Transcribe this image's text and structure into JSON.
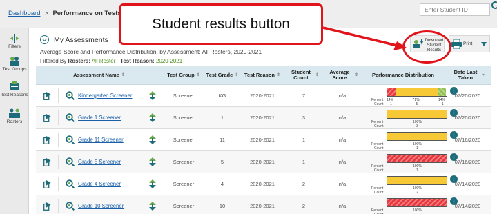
{
  "breadcrumb": {
    "root": "Dashboard",
    "separator": ">",
    "current": "Performance on Tests"
  },
  "search": {
    "placeholder": "Enter Student ID"
  },
  "callout": {
    "text": "Student results button"
  },
  "rail": [
    {
      "label": "Filters",
      "icon": "filters-icon"
    },
    {
      "label": "Test Groups",
      "icon": "test-groups-icon"
    },
    {
      "label": "Test Reasons",
      "icon": "test-reasons-icon"
    },
    {
      "label": "Rosters",
      "icon": "rosters-icon"
    }
  ],
  "page": {
    "title": "My Assessments",
    "subtitle": "Average Score and Performance Distribution, by Assessment: All Rosters, 2020-2021",
    "filtered_by": "Filtered By",
    "rosters_label": "Rosters:",
    "rosters_value": "All Roster",
    "reason_label": "Test Reason:",
    "reason_value": "2020-2021"
  },
  "toolbar": {
    "download_label": "Download Student Results",
    "print_label": "Print"
  },
  "colors": {
    "accent": "#1d6c7b",
    "link": "#1a5fa8",
    "callout": "#e0141a",
    "header_bg": "#d9e9ef"
  },
  "table": {
    "headers": {
      "name": "Assessment Name",
      "group": "Test Group",
      "grade": "Test Grade",
      "reason": "Test Reason",
      "count": "Student Count",
      "score": "Average Score",
      "perf": "Performance Distribution",
      "date": "Date Last Taken"
    },
    "rows": [
      {
        "name": "Kindergarten Screener",
        "group": "Screener",
        "grade": "KG",
        "reason": "2020-2021",
        "count": "7",
        "score": "n/a",
        "date": "07/20/2020",
        "perf": {
          "segments": [
            {
              "color": "red",
              "pct": 14
            },
            {
              "color": "yellow",
              "pct": 71
            },
            {
              "color": "green",
              "pct": 14
            }
          ],
          "percent_label": "Percent",
          "count_label": "Count",
          "percents": [
            "14%",
            "71%",
            "14%"
          ],
          "counts": [
            "1",
            "5",
            "1"
          ]
        }
      },
      {
        "name": "Grade 1 Screener",
        "group": "Screener",
        "grade": "1",
        "reason": "2020-2021",
        "count": "3",
        "score": "n/a",
        "date": "07/20/2020",
        "perf": {
          "segments": [
            {
              "color": "yellow",
              "pct": 100
            }
          ],
          "percent_label": "Percent",
          "count_label": "Count",
          "percents": [
            "100%"
          ],
          "counts": [
            "3"
          ]
        }
      },
      {
        "name": "Grade 11 Screener",
        "group": "Screener",
        "grade": "11",
        "reason": "2020-2021",
        "count": "1",
        "score": "n/a",
        "date": "07/16/2020",
        "perf": {
          "segments": [
            {
              "color": "yellow",
              "pct": 100
            }
          ],
          "percent_label": "Percent",
          "count_label": "Count",
          "percents": [
            "100%"
          ],
          "counts": [
            "1"
          ]
        }
      },
      {
        "name": "Grade 5 Screener",
        "group": "Screener",
        "grade": "5",
        "reason": "2020-2021",
        "count": "1",
        "score": "n/a",
        "date": "07/16/2020",
        "perf": {
          "segments": [
            {
              "color": "red",
              "pct": 100
            }
          ],
          "percent_label": "Percent",
          "count_label": "Count",
          "percents": [
            "100%"
          ],
          "counts": [
            "1"
          ]
        }
      },
      {
        "name": "Grade 4 Screener",
        "group": "Screener",
        "grade": "4",
        "reason": "2020-2021",
        "count": "2",
        "score": "n/a",
        "date": "07/14/2020",
        "perf": {
          "segments": [
            {
              "color": "yellow",
              "pct": 100
            }
          ],
          "percent_label": "Percent",
          "count_label": "Count",
          "percents": [
            "100%"
          ],
          "counts": [
            "2"
          ]
        }
      },
      {
        "name": "Grade 10 Screener",
        "group": "Screener",
        "grade": "10",
        "reason": "2020-2021",
        "count": "2",
        "score": "n/a",
        "date": "07/14/2020",
        "perf": {
          "segments": [
            {
              "color": "red",
              "pct": 100
            }
          ],
          "percent_label": "Percent",
          "count_label": "Count",
          "percents": [
            "100%"
          ],
          "counts": []
        }
      }
    ]
  }
}
